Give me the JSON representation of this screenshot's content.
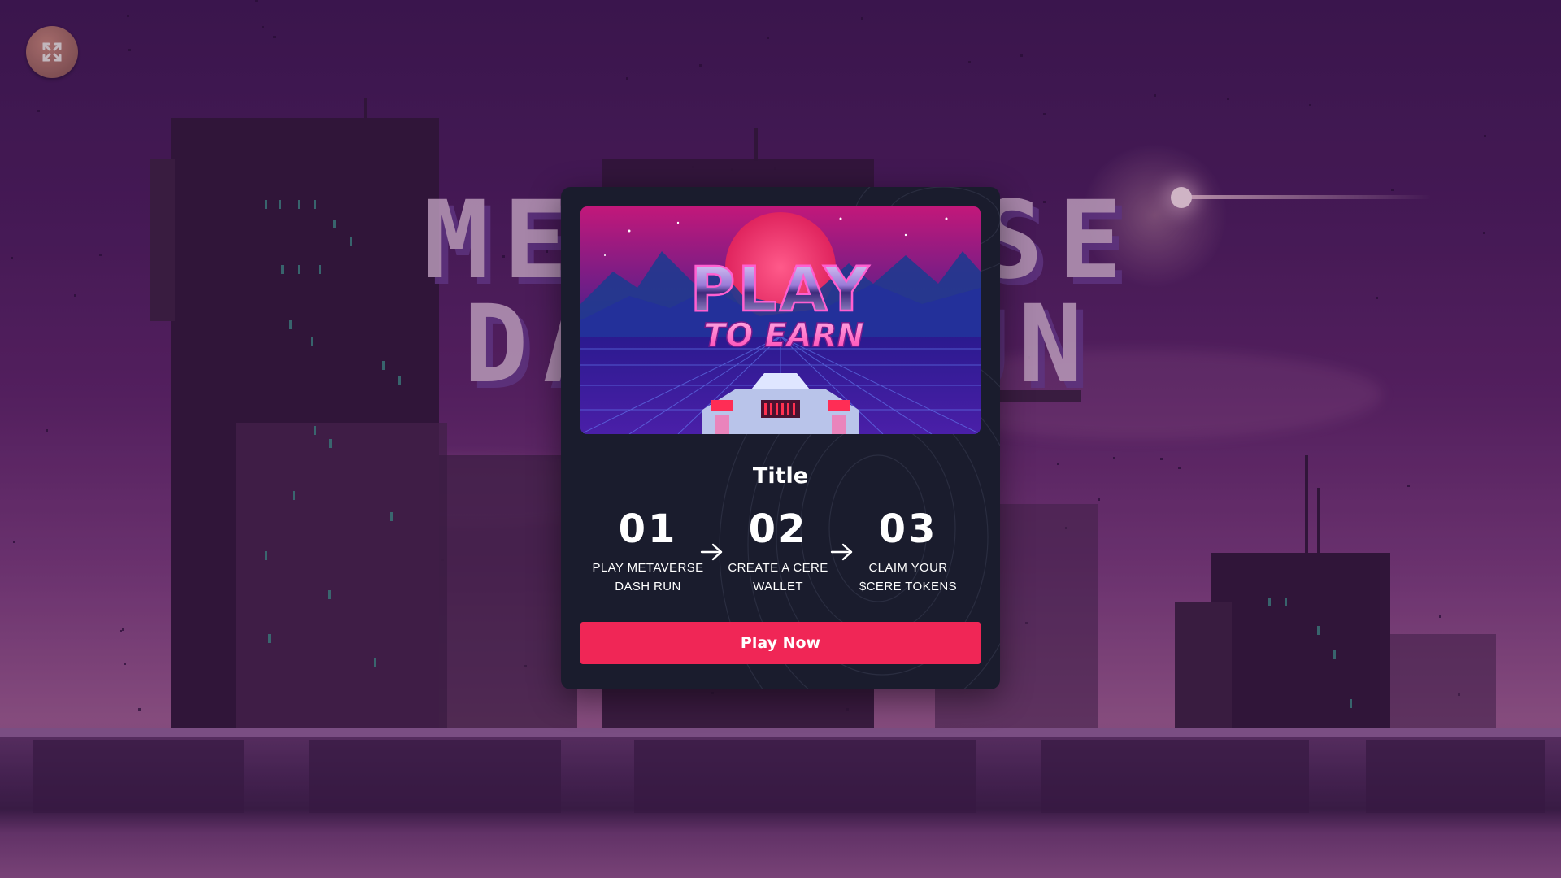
{
  "game": {
    "background_title_lines": [
      "METAVERSE",
      "DASH RUN"
    ]
  },
  "fullscreen_button": {
    "icon": "fullscreen-expand-icon"
  },
  "modal": {
    "hero_image": {
      "headline": "PLAY",
      "subheadline": "TO EARN"
    },
    "title": "Title",
    "steps": [
      {
        "number": "01",
        "label": "PLAY METAVERSE DASH RUN"
      },
      {
        "number": "02",
        "label": "CREATE A CERE WALLET"
      },
      {
        "number": "03",
        "label": "CLAIM YOUR $CERE TOKENS"
      }
    ],
    "step_arrow_icon": "arrow-right-icon",
    "cta_label": "Play Now",
    "colors": {
      "panel": "#1a1c2d",
      "cta": "#f02656",
      "text": "#ffffff"
    }
  }
}
